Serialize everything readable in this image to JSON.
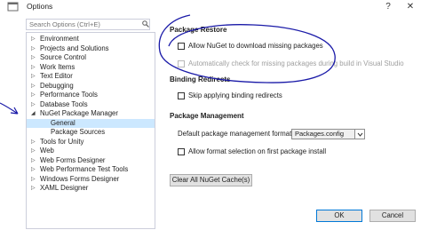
{
  "window": {
    "title": "Options",
    "minimize_glyph": "?",
    "close_glyph": "✕"
  },
  "search": {
    "placeholder": "Search Options (Ctrl+E)"
  },
  "tree": {
    "items": [
      {
        "label": "Environment",
        "expanded": false
      },
      {
        "label": "Projects and Solutions",
        "expanded": false
      },
      {
        "label": "Source Control",
        "expanded": false
      },
      {
        "label": "Work Items",
        "expanded": false
      },
      {
        "label": "Text Editor",
        "expanded": false
      },
      {
        "label": "Debugging",
        "expanded": false
      },
      {
        "label": "Performance Tools",
        "expanded": false
      },
      {
        "label": "Database Tools",
        "expanded": false
      },
      {
        "label": "NuGet Package Manager",
        "expanded": true
      },
      {
        "label": "General",
        "child": true,
        "selected": true
      },
      {
        "label": "Package Sources",
        "child": true
      },
      {
        "label": "Tools for Unity",
        "expanded": false
      },
      {
        "label": "Web",
        "expanded": false
      },
      {
        "label": "Web Forms Designer",
        "expanded": false
      },
      {
        "label": "Web Performance Test Tools",
        "expanded": false
      },
      {
        "label": "Windows Forms Designer",
        "expanded": false
      },
      {
        "label": "XAML Designer",
        "expanded": false
      }
    ]
  },
  "package_restore": {
    "heading": "Package Restore",
    "allow_download": {
      "label": "Allow NuGet to download missing packages",
      "checked": false
    },
    "auto_check": {
      "label": "Automatically check for missing packages during build in Visual Studio",
      "checked": false,
      "disabled": true
    }
  },
  "binding_redirects": {
    "heading": "Binding Redirects",
    "skip": {
      "label": "Skip applying binding redirects",
      "checked": false
    }
  },
  "package_management": {
    "heading": "Package Management",
    "format_label": "Default package management format:",
    "format_value": "Packages.config",
    "allow_format": {
      "label": "Allow format selection on first package install",
      "checked": false
    }
  },
  "buttons": {
    "clear_cache": "Clear All NuGet Cache(s)",
    "ok": "OK",
    "cancel": "Cancel"
  },
  "colors": {
    "annotation_ink": "#1a1aa8",
    "selection": "#cce8ff"
  }
}
